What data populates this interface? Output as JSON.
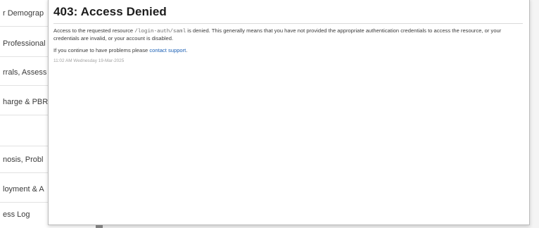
{
  "sidebar": {
    "items": [
      {
        "label": "r Demograp"
      },
      {
        "label": "Professional"
      },
      {
        "label": "rrals, Assess"
      },
      {
        "label": "harge & PBR"
      },
      {
        "label": ""
      },
      {
        "label": "nosis, Probl"
      },
      {
        "label": "loyment & A"
      },
      {
        "label": "ess Log"
      }
    ]
  },
  "error": {
    "title": "403: Access Denied",
    "message_prefix": "Access to the requested resource ",
    "resource_path": "/login-auth/saml",
    "message_suffix": " is denied. This generally means that you have not provided the appropriate authentication credentials to access the resource, or your credentials are invalid, or your account is disabled.",
    "help_prefix": "If you continue to have problems please ",
    "help_link": "contact support",
    "help_suffix": ".",
    "timestamp": "11:02 AM Wednesday 19-Mar-2025"
  },
  "colors": {
    "link": "#1a5fb4",
    "title": "#1c1c1c",
    "muted": "#a3a3a3"
  }
}
